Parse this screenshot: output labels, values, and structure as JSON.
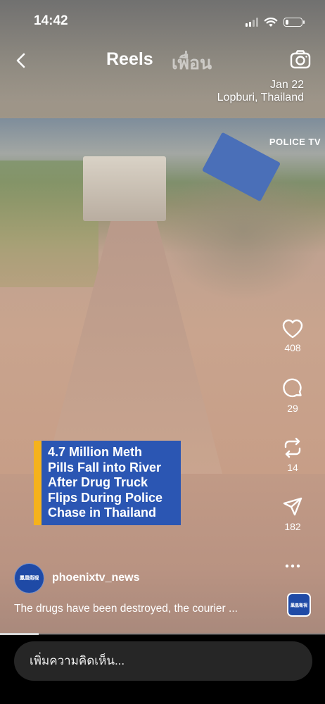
{
  "status_bar": {
    "time": "14:42",
    "signal_bars_active": 2,
    "signal_bars_total": 4,
    "battery_level": 0.2,
    "icons": [
      "signal-icon",
      "wifi-icon",
      "battery-icon"
    ]
  },
  "header": {
    "back_icon": "chevron-left-icon",
    "tabs": [
      {
        "label": "Reels",
        "active": true
      },
      {
        "label": "เพื่อน",
        "active": false
      }
    ],
    "camera_icon": "camera-icon"
  },
  "video": {
    "date_overlay": "Jan 22",
    "location_overlay": "Lopburi, Thailand",
    "watermark": "POLICE TV",
    "headline_lines": [
      "4.7 Million Meth",
      "Pills Fall into River",
      "After Drug Truck",
      "Flips During Police",
      "Chase in Thailand"
    ],
    "headline_accent": "#f5b21c",
    "headline_bg": "#2b56b3"
  },
  "actions": {
    "like": {
      "icon": "heart-icon",
      "count": "408"
    },
    "comment": {
      "icon": "comment-icon",
      "count": "29"
    },
    "repost": {
      "icon": "repost-icon",
      "count": "14"
    },
    "share": {
      "icon": "send-icon",
      "count": "182"
    },
    "more": {
      "icon": "more-icon"
    }
  },
  "post": {
    "username": "phoenixtv_news",
    "avatar_text": "鳳凰衛視",
    "caption": "The drugs have been destroyed, the courier ..."
  },
  "playback": {
    "progress": 0.12
  },
  "comment_box": {
    "placeholder": "เพิ่มความคิดเห็น..."
  }
}
